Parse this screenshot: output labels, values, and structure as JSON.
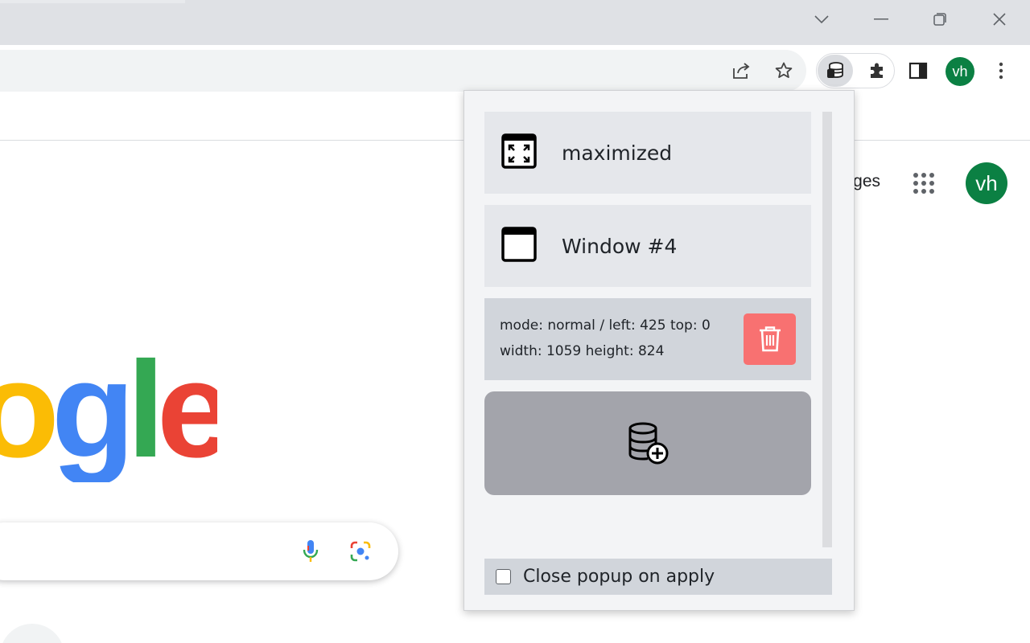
{
  "browser": {
    "avatar_initials": "vh",
    "page_link_partial": "ges",
    "page_avatar_initials": "vh"
  },
  "google": {
    "logo_visible": "ogle",
    "logo_colors": [
      "#fbbc05",
      "#4285f4",
      "#34a853",
      "#ea4335"
    ]
  },
  "popup": {
    "items": [
      {
        "icon": "maximize-window-icon",
        "label": "maximized"
      },
      {
        "icon": "window-icon",
        "label": "Window #4"
      }
    ],
    "detail": {
      "line1": "mode: normal / left: 425 top: 0",
      "line2": "width: 1059 height: 824"
    },
    "add_button_icon": "database-add-icon",
    "delete_button_icon": "trash-icon",
    "footer_checkbox_label": "Close popup on apply",
    "footer_checkbox_checked": false
  },
  "colors": {
    "avatar": "#0b8043",
    "delete": "#f87171",
    "add_button": "#a3a4ab"
  }
}
